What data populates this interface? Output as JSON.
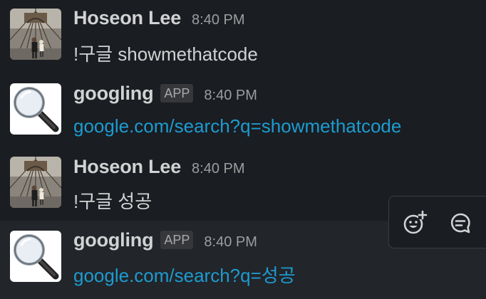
{
  "messages": [
    {
      "sender": "Hoseon Lee",
      "time": "8:40 PM",
      "text": "!구글 showmethatcode"
    },
    {
      "sender": "googling",
      "badge": "APP",
      "time": "8:40 PM",
      "link": "google.com/search?q=showmethatcode"
    },
    {
      "sender": "Hoseon Lee",
      "time": "8:40 PM",
      "text": "!구글 성공"
    },
    {
      "sender": "googling",
      "badge": "APP",
      "time": "8:40 PM",
      "link": "google.com/search?q=성공"
    }
  ],
  "hover_actions": [
    {
      "icon": "add-reaction-icon"
    },
    {
      "icon": "reply-in-thread-icon"
    }
  ],
  "colors": {
    "background": "#1a1d21",
    "hover_background": "#222529",
    "text": "#d1d2d3",
    "link": "#1d9bd1",
    "timestamp": "#9c9d9f"
  }
}
